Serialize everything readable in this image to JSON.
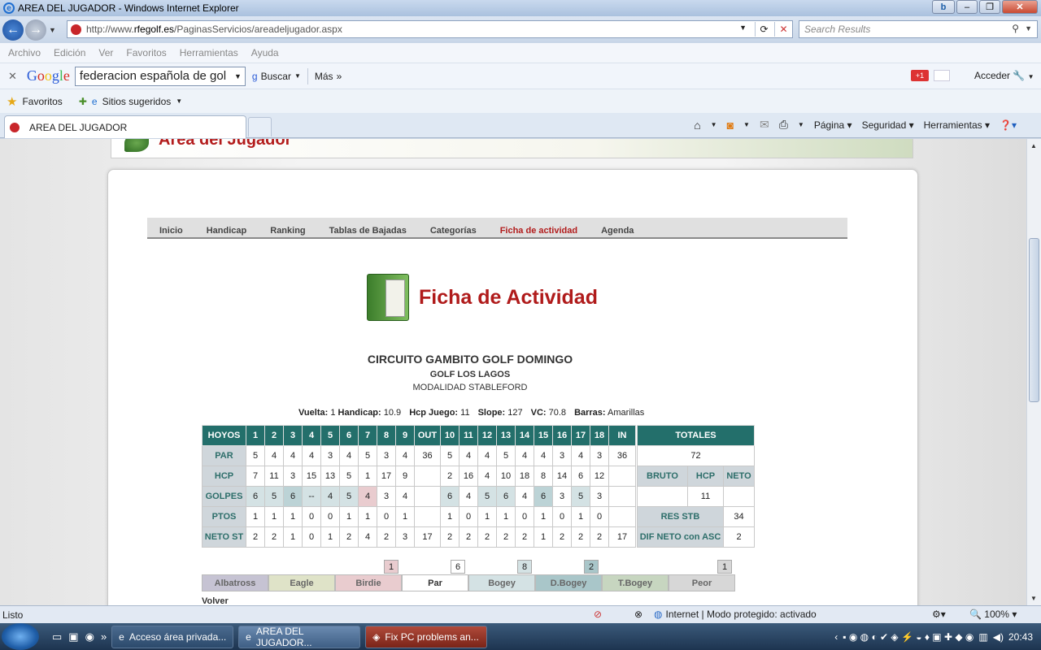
{
  "window": {
    "title": "AREA DEL JUGADOR - Windows Internet Explorer"
  },
  "address": {
    "url_prefix": "http://www.",
    "url_domain": "rfegolf.es",
    "url_path": "/PaginasServicios/areadeljugador.aspx",
    "search_placeholder": "Search Results"
  },
  "menu": [
    "Archivo",
    "Edición",
    "Ver",
    "Favoritos",
    "Herramientas",
    "Ayuda"
  ],
  "google": {
    "logo": "Google",
    "query": "federacion española de gol",
    "buscar": "Buscar",
    "mas": "Más",
    "gplus": "+1",
    "acceder": "Acceder"
  },
  "favorites": {
    "label": "Favoritos",
    "suggested": "Sitios sugeridos"
  },
  "tab": {
    "title": "AREA DEL JUGADOR"
  },
  "commandbar": {
    "pagina": "Página",
    "seguridad": "Seguridad",
    "herramientas": "Herramientas"
  },
  "banner": {
    "title": "Área del Jugador"
  },
  "subnav": [
    "Inicio",
    "Handicap",
    "Ranking",
    "Tablas de Bajadas",
    "Categorías",
    "Ficha de actividad",
    "Agenda"
  ],
  "ficha": {
    "title": "Ficha de Actividad"
  },
  "competition": {
    "name": "CIRCUITO GAMBITO GOLF DOMINGO",
    "course": "GOLF LOS LAGOS",
    "mode": "MODALIDAD STABLEFORD"
  },
  "info": {
    "vuelta_label": "Vuelta:",
    "vuelta": "1",
    "handicap_label": "Handicap:",
    "handicap": "10.9",
    "hcp_juego_label": "Hcp Juego:",
    "hcp_juego": "11",
    "slope_label": "Slope:",
    "slope": "127",
    "vc_label": "VC:",
    "vc": "70.8",
    "barras_label": "Barras:",
    "barras": "Amarillas"
  },
  "scorecard": {
    "headers": [
      "HOYOS",
      "1",
      "2",
      "3",
      "4",
      "5",
      "6",
      "7",
      "8",
      "9",
      "OUT",
      "10",
      "11",
      "12",
      "13",
      "14",
      "15",
      "16",
      "17",
      "18",
      "IN"
    ],
    "totales": "TOTALES",
    "par_label": "PAR",
    "par": [
      "5",
      "4",
      "4",
      "4",
      "3",
      "4",
      "5",
      "3",
      "4",
      "36",
      "5",
      "4",
      "4",
      "5",
      "4",
      "4",
      "3",
      "4",
      "3",
      "36"
    ],
    "par_total": "72",
    "hcp_label": "HCP",
    "hcp": [
      "7",
      "11",
      "3",
      "15",
      "13",
      "5",
      "1",
      "17",
      "9",
      "",
      "2",
      "16",
      "4",
      "10",
      "18",
      "8",
      "14",
      "6",
      "12",
      ""
    ],
    "bruto": "BRUTO",
    "hcp_col": "HCP",
    "neto": "NETO",
    "golpes_label": "GOLPES",
    "golpes": [
      "6",
      "5",
      "6",
      "--",
      "4",
      "5",
      "4",
      "3",
      "4",
      "",
      "6",
      "4",
      "5",
      "6",
      "4",
      "6",
      "3",
      "5",
      "3",
      ""
    ],
    "golpes_bruto": "",
    "golpes_hcp": "11",
    "golpes_neto": "",
    "ptos_label": "PTOS",
    "ptos": [
      "1",
      "1",
      "1",
      "0",
      "0",
      "1",
      "1",
      "0",
      "1",
      "",
      "1",
      "0",
      "1",
      "1",
      "0",
      "1",
      "0",
      "1",
      "0",
      ""
    ],
    "res_stb_label": "RES STB",
    "res_stb": "34",
    "neto_label": "NETO ST",
    "neto_st": [
      "2",
      "2",
      "1",
      "0",
      "1",
      "2",
      "4",
      "2",
      "3",
      "17",
      "2",
      "2",
      "2",
      "2",
      "2",
      "1",
      "2",
      "2",
      "2",
      "17"
    ],
    "dif_label": "DIF NETO con ASC",
    "dif": "2"
  },
  "legend": [
    {
      "label": "Albatross",
      "count": ""
    },
    {
      "label": "Eagle",
      "count": ""
    },
    {
      "label": "Birdie",
      "count": "1"
    },
    {
      "label": "Par",
      "count": "6"
    },
    {
      "label": "Bogey",
      "count": "8"
    },
    {
      "label": "D.Bogey",
      "count": "2"
    },
    {
      "label": "T.Bogey",
      "count": ""
    },
    {
      "label": "Peor",
      "count": "1"
    }
  ],
  "legend_colors": {
    "Albatross": "#c6c3d3",
    "Eagle": "#dfe3c8",
    "Birdie": "#e9cccf",
    "Par": "#ffffff",
    "Bogey": "#d4e2e4",
    "D.Bogey": "#a9c6c9",
    "T.Bogey": "#c7d6c0",
    "Peor": "#d7d7d7"
  },
  "legend_count_colors": {
    "Birdie": "#e9cccf",
    "Par": "#ffffff",
    "Bogey": "#d4e2e4",
    "D.Bogey": "#a9c6c9",
    "Peor": "#d7d7d7"
  },
  "volver": "Volver",
  "status": {
    "text": "Listo",
    "zone": "Internet | Modo protegido: activado",
    "zoom": "100%"
  },
  "taskbar": {
    "tasks": [
      "Acceso área privada...",
      "AREA DEL JUGADOR...",
      "Fix PC problems an..."
    ],
    "time": "20:43"
  }
}
